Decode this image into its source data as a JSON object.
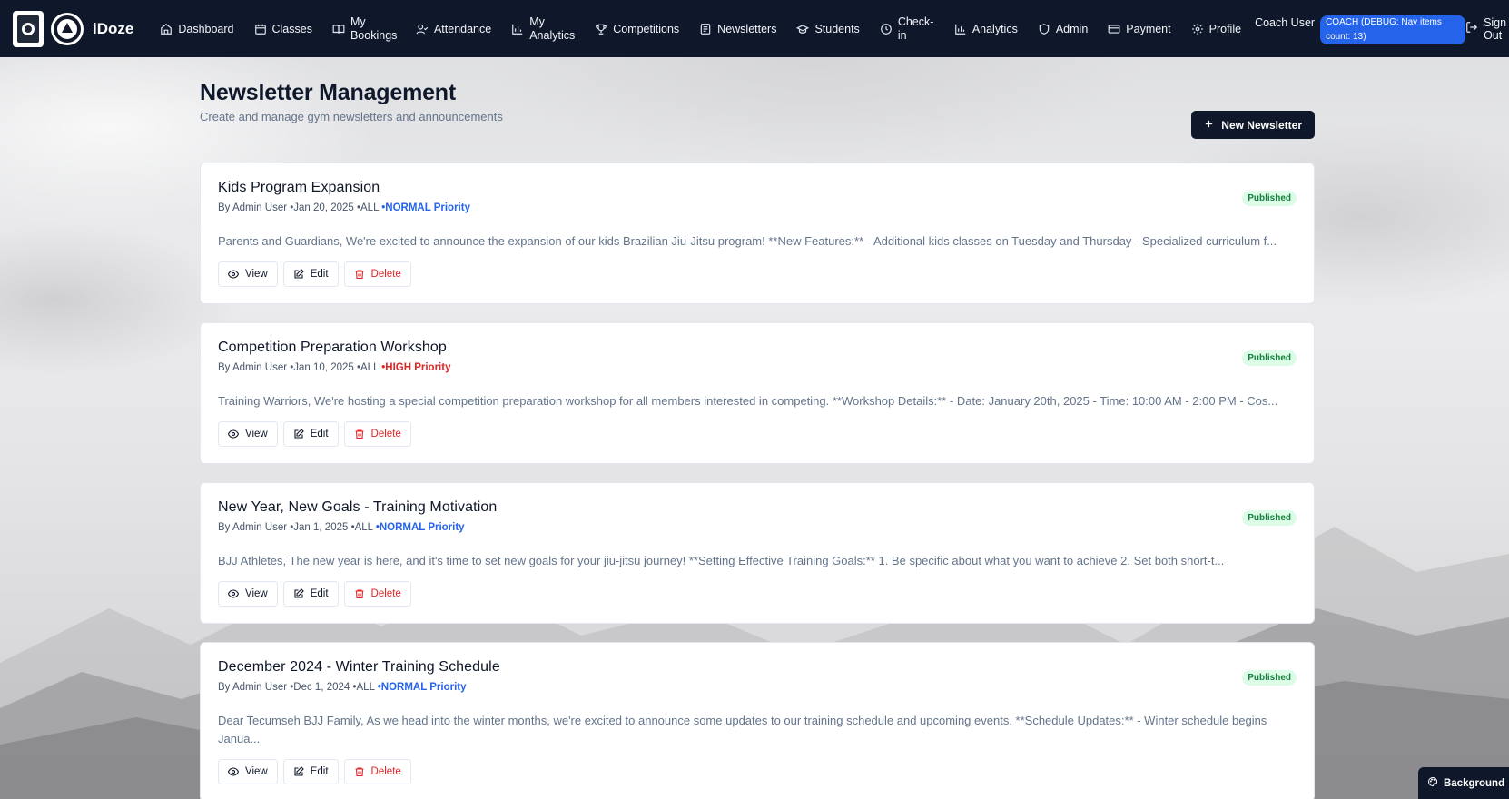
{
  "app": {
    "brand": "iDoze"
  },
  "nav": {
    "items": [
      {
        "label": "Dashboard",
        "icon": "home-icon"
      },
      {
        "label": "Classes",
        "icon": "calendar-icon"
      },
      {
        "label": "My Bookings",
        "icon": "book-icon"
      },
      {
        "label": "Attendance",
        "icon": "user-check-icon"
      },
      {
        "label": "My Analytics",
        "icon": "bar-chart-icon"
      },
      {
        "label": "Competitions",
        "icon": "trophy-icon"
      },
      {
        "label": "Newsletters",
        "icon": "newspaper-icon"
      },
      {
        "label": "Students",
        "icon": "graduation-cap-icon"
      },
      {
        "label": "Check-in",
        "icon": "clock-icon"
      },
      {
        "label": "Analytics",
        "icon": "bar-chart-icon"
      },
      {
        "label": "Admin",
        "icon": "shield-icon"
      },
      {
        "label": "Payment",
        "icon": "credit-card-icon"
      },
      {
        "label": "Profile",
        "icon": "gear-icon"
      }
    ],
    "user_name": "Coach User",
    "debug_badge": "COACH (DEBUG: Nav items count: 13)",
    "sign_out": "Sign Out"
  },
  "page": {
    "title": "Newsletter Management",
    "subtitle": "Create and manage gym newsletters and announcements",
    "new_button": "New Newsletter"
  },
  "newsletters": [
    {
      "title": "Kids Program Expansion",
      "meta_prefix": "By Admin User •Jan 20, 2025 •ALL ",
      "priority": "•NORMAL Priority",
      "status": "Published",
      "excerpt": "Parents and Guardians, We're excited to announce the expansion of our kids Brazilian Jiu-Jitsu program! **New Features:** - Additional kids classes on Tuesday and Thursday - Specialized curriculum f..."
    },
    {
      "title": "Competition Preparation Workshop",
      "meta_prefix": "By Admin User •Jan 10, 2025 •ALL ",
      "priority": "•HIGH Priority",
      "status": "Published",
      "excerpt": "Training Warriors, We're hosting a special competition preparation workshop for all members interested in competing. **Workshop Details:** - Date: January 20th, 2025 - Time: 10:00 AM - 2:00 PM - Cos..."
    },
    {
      "title": "New Year, New Goals - Training Motivation",
      "meta_prefix": "By Admin User •Jan 1, 2025 •ALL ",
      "priority": "•NORMAL Priority",
      "status": "Published",
      "excerpt": "BJJ Athletes, The new year is here, and it's time to set new goals for your jiu-jitsu journey! **Setting Effective Training Goals:** 1. Be specific about what you want to achieve 2. Set both short-t..."
    },
    {
      "title": "December 2024 - Winter Training Schedule",
      "meta_prefix": "By Admin User •Dec 1, 2024 •ALL ",
      "priority": "•NORMAL Priority",
      "status": "Published",
      "excerpt": "Dear Tecumseh BJJ Family, As we head into the winter months, we're excited to announce some updates to our training schedule and upcoming events. **Schedule Updates:** - Winter schedule begins Janua..."
    }
  ],
  "card_actions": {
    "view": "View",
    "edit": "Edit",
    "delete": "Delete"
  },
  "background_toggle": "Background",
  "colors": {
    "nav_bg": "#0f172a",
    "priority_normal": "#2563eb",
    "priority_high": "#dc2626",
    "published_bg": "#dcfce7",
    "published_text": "#15803d",
    "danger": "#dc2626"
  }
}
